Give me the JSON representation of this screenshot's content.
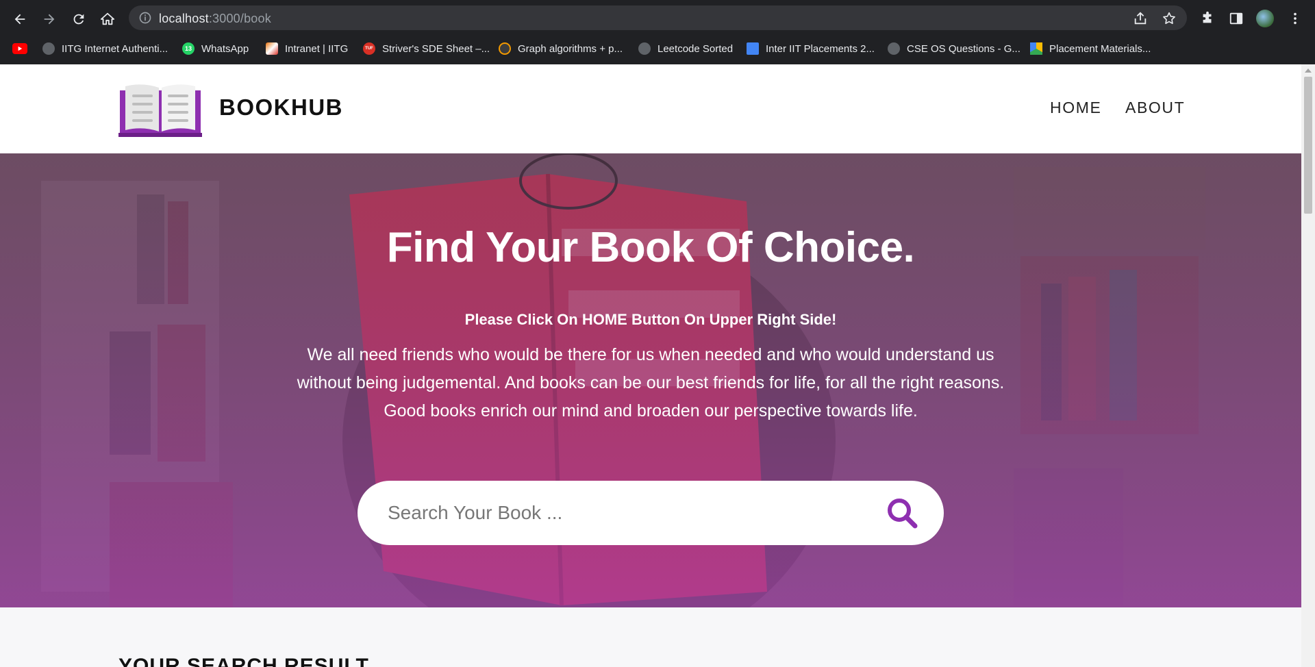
{
  "browser": {
    "url_host": "localhost",
    "url_path": ":3000/book",
    "bookmarks": [
      {
        "label": "IITG Internet Authenti...",
        "icon": "globe-icon",
        "color": "#5f6368"
      },
      {
        "label": "WhatsApp",
        "icon": "whatsapp-icon",
        "color": "#25d366",
        "badge": "13"
      },
      {
        "label": "Intranet | IITG",
        "icon": "iitg-icon",
        "color": "#e8710a"
      },
      {
        "label": "Striver's SDE Sheet –...",
        "icon": "tuf-icon",
        "color": "#d93025",
        "badge": "TUF"
      },
      {
        "label": "Graph algorithms + p...",
        "icon": "graph-icon",
        "color": "#f29900"
      },
      {
        "label": "Leetcode Sorted",
        "icon": "globe-icon",
        "color": "#5f6368"
      },
      {
        "label": "Inter IIT Placements 2...",
        "icon": "docs-icon",
        "color": "#4285f4"
      },
      {
        "label": "CSE OS Questions - G...",
        "icon": "globe-icon",
        "color": "#5f6368"
      },
      {
        "label": "Placement Materials...",
        "icon": "drive-icon",
        "color": "#fbbc04"
      }
    ]
  },
  "site": {
    "brand": "BOOKHUB",
    "nav": {
      "home": "HOME",
      "about": "ABOUT"
    },
    "accent": "#8e2fb0"
  },
  "hero": {
    "title": "Find Your Book Of Choice.",
    "subtitle": "Please Click On HOME Button On Upper Right Side!",
    "description": "We all need friends who would be there for us when needed and who would understand us without being judgemental. And books can be our best friends for life, for all the right reasons. Good books enrich our mind and broaden our perspective towards life.",
    "search_placeholder": "Search Your Book ..."
  },
  "results": {
    "title": "YOUR SEARCH RESULT"
  }
}
